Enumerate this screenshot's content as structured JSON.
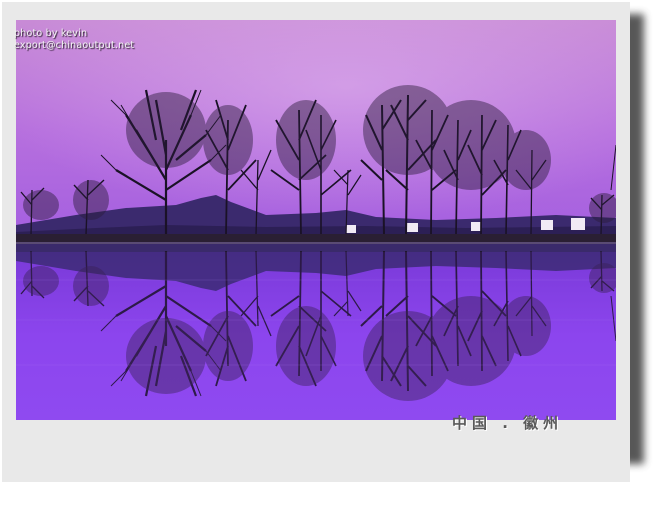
{
  "photo": {
    "watermark": {
      "line1": "photo by kevin",
      "line2": "export@chinaoutput.net"
    },
    "caption": "中国 . 徽州",
    "colors": {
      "sky_top": "#c78ad8",
      "sky_mid": "#b46ee0",
      "water": "#8a3ff0",
      "mountain": "#2a1f5a",
      "tree": "#1a1226",
      "frame": "#e9e9e9"
    }
  }
}
